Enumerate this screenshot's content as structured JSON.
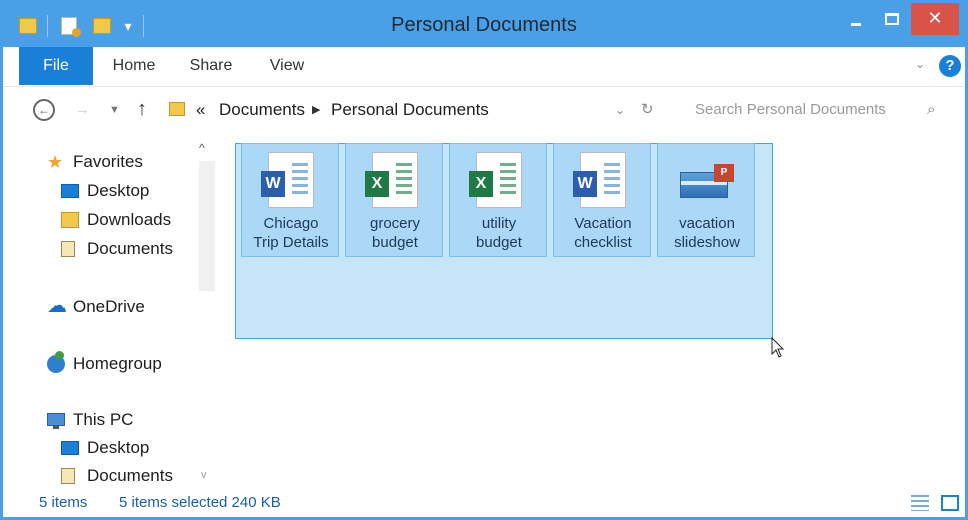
{
  "window": {
    "title": "Personal Documents"
  },
  "titlebar": {
    "close_glyph": "✕",
    "qat_arrow": "▾"
  },
  "ribbon": {
    "tabs": [
      "File",
      "Home",
      "Share",
      "View"
    ],
    "expand_glyph": "⌄",
    "help_glyph": "?"
  },
  "address": {
    "back_glyph": "←",
    "forward_glyph": "→",
    "recent_glyph": "▼",
    "up_glyph": "↑",
    "overflow_glyph": "«",
    "separator_glyph": "▶",
    "crumbs": [
      "Documents",
      "Personal Documents"
    ],
    "dropdown_glyph": "⌄",
    "refresh_glyph": "↻"
  },
  "search": {
    "placeholder": "Search Personal Documents",
    "icon_glyph": "⌕"
  },
  "nav": {
    "favorites": "Favorites",
    "desktop": "Desktop",
    "downloads": "Downloads",
    "documents": "Documents",
    "onedrive": "OneDrive",
    "homegroup": "Homegroup",
    "thispc": "This PC",
    "pc_desktop": "Desktop",
    "pc_documents": "Documents",
    "star_glyph": "★",
    "cloud_glyph": "☁",
    "scroll_up_glyph": "^",
    "scroll_down_glyph": "v"
  },
  "files": [
    {
      "name_line1": "Chicago",
      "name_line2": "Trip Details",
      "type": "word",
      "badge": "W"
    },
    {
      "name_line1": "grocery",
      "name_line2": "budget",
      "type": "excel",
      "badge": "X"
    },
    {
      "name_line1": "utility",
      "name_line2": "budget",
      "type": "excel",
      "badge": "X"
    },
    {
      "name_line1": "Vacation",
      "name_line2": "checklist",
      "type": "word",
      "badge": "W"
    },
    {
      "name_line1": "vacation",
      "name_line2": "slideshow",
      "type": "powerpoint",
      "badge": "P"
    }
  ],
  "status": {
    "count": "5 items",
    "selection": "5 items selected  240 KB"
  },
  "colors": {
    "titlebar": "#4aa0e6",
    "file_tab": "#1a7fd6",
    "selection": "#c6e6f8",
    "close": "#d9534a"
  }
}
